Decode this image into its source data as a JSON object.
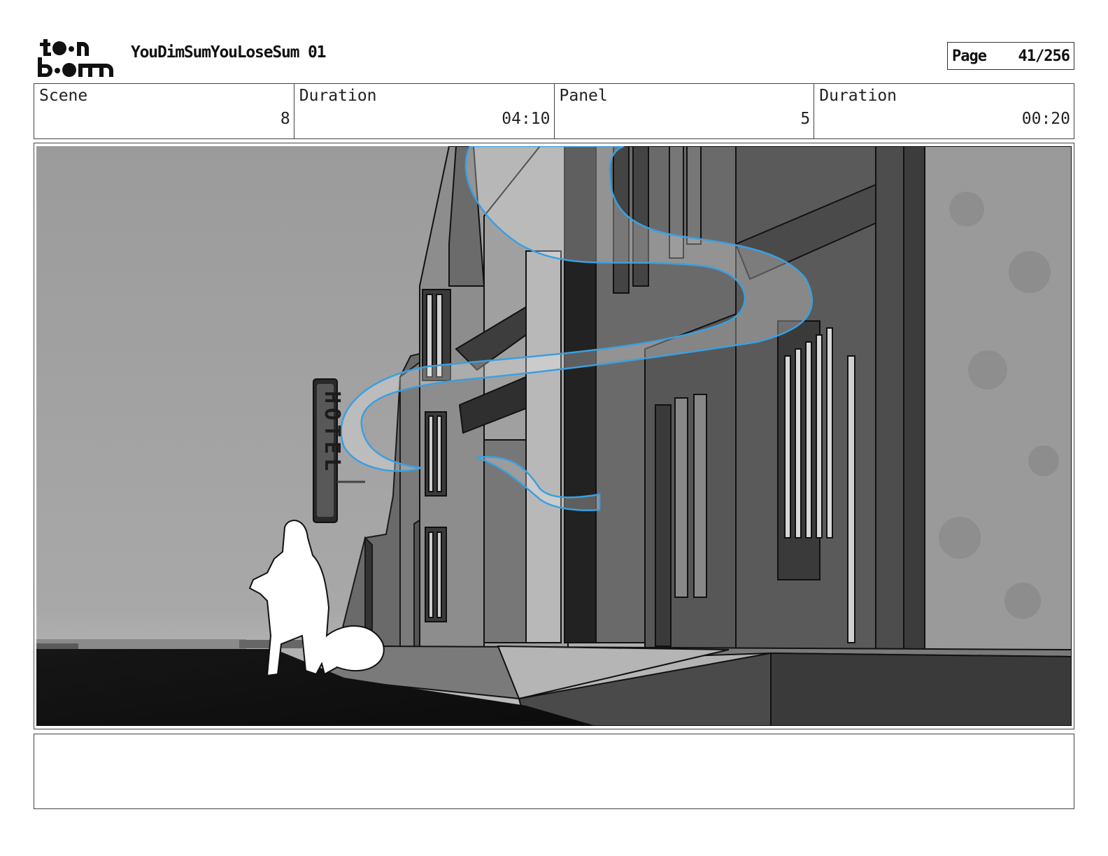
{
  "header": {
    "logo_text": "toon boom",
    "project_title": "YouDimSumYouLoseSum 01",
    "page_label": "Page",
    "page_number": "41/256"
  },
  "info": {
    "scene_label": "Scene",
    "scene_value": "8",
    "scene_duration_label": "Duration",
    "scene_duration_value": "04:10",
    "panel_label": "Panel",
    "panel_value": "5",
    "panel_duration_label": "Duration",
    "panel_duration_value": "00:20"
  },
  "panel": {
    "sign_text": "HOTEL",
    "path_color": "#3aa0e0"
  },
  "notes": {
    "text": ""
  }
}
